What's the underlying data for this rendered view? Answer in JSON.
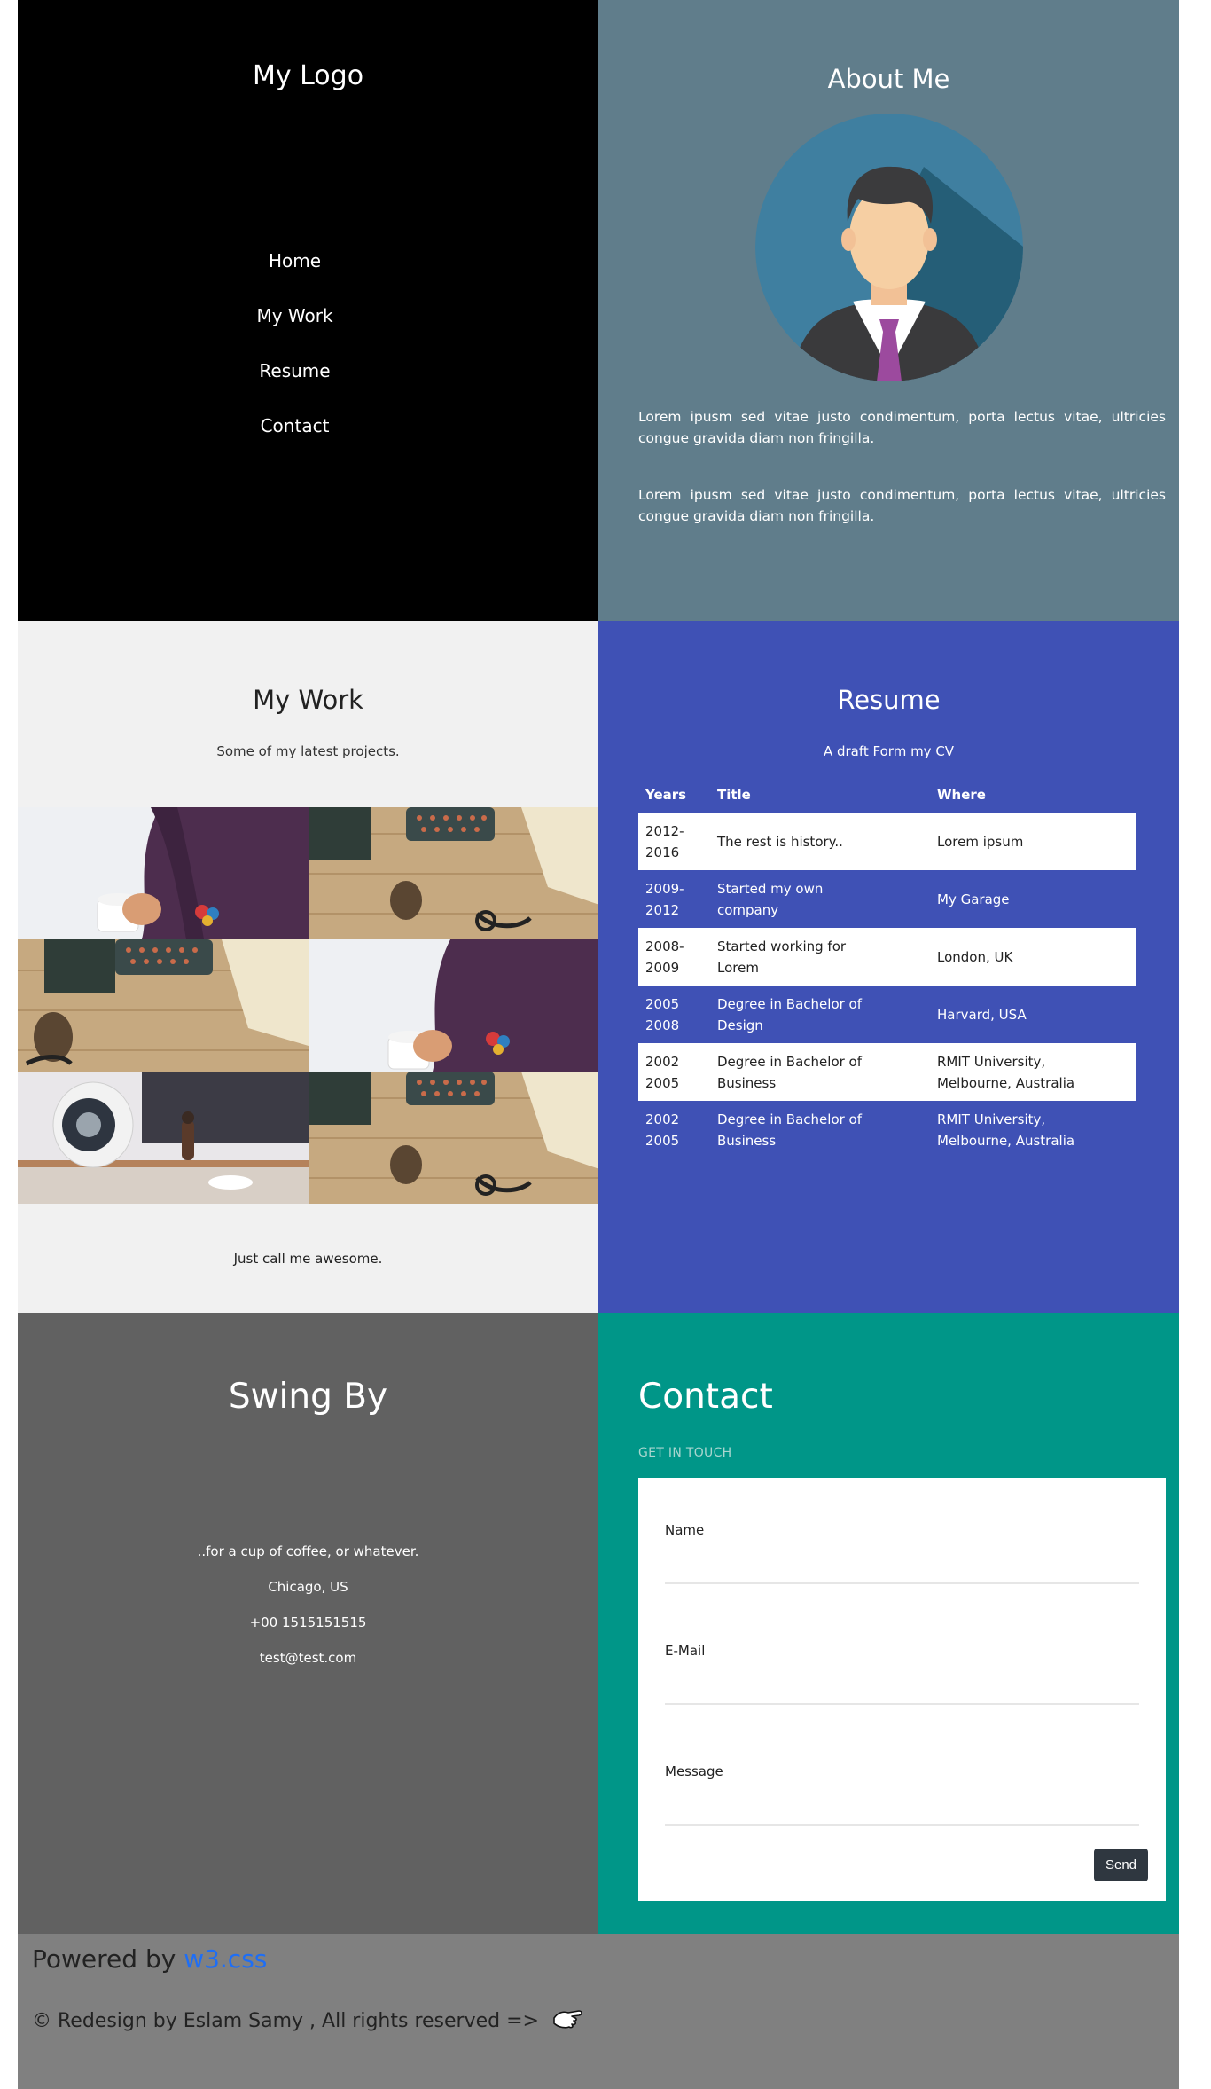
{
  "sidebar": {
    "logo": "My Logo",
    "nav": [
      "Home",
      "My Work",
      "Resume",
      "Contact"
    ]
  },
  "about": {
    "title": "About Me",
    "paragraphs": [
      "Lorem ipusm sed vitae justo condimentum, porta lectus vitae, ultricies congue gravida diam non fringilla.",
      "Lorem ipusm sed vitae justo condimentum, porta lectus vitae, ultricies congue gravida diam non fringilla."
    ]
  },
  "work": {
    "title": "My Work",
    "subtitle": "Some of my latest projects.",
    "tiles": [
      "coffee-vest-photo",
      "typewriter-desk-photo",
      "typewriter-desk-photo",
      "coffee-vest-photo",
      "speaker-desk-photo",
      "typewriter-desk-photo"
    ],
    "footer": "Just call me awesome."
  },
  "resume": {
    "title": "Resume",
    "subtitle": "A draft Form my CV",
    "headers": [
      "Years",
      "Title",
      "Where"
    ],
    "rows": [
      {
        "years": "2012-\n2016",
        "title": " The rest is history..",
        "where": " Lorem ipsum"
      },
      {
        "years": "2009-\n2012",
        "title": "Started my own\ncompany",
        "where": "My Garage"
      },
      {
        "years": "2008-\n2009",
        "title": "Started working for\nLorem",
        "where": "London, UK"
      },
      {
        "years": "2005\n2008",
        "title": "Degree in Bachelor of\nDesign",
        "where": "Harvard, USA"
      },
      {
        "years": "2002\n2005",
        "title": "Degree in Bachelor of\nBusiness",
        "where": "RMIT University,\nMelbourne, Australia"
      },
      {
        "years": "2002\n2005",
        "title": "Degree in Bachelor of\nBusiness",
        "where": "RMIT University,\nMelbourne, Australia"
      }
    ]
  },
  "swing": {
    "title": "Swing By",
    "lines": [
      "..for a cup of coffee, or whatever.",
      "Chicago, US",
      "+00 1515151515",
      "test@test.com"
    ]
  },
  "contact": {
    "title": "Contact",
    "tagline": "GET IN TOUCH",
    "fields": [
      "Name",
      "E-Mail",
      "Message"
    ],
    "send": "Send"
  },
  "footer": {
    "powered_prefix": "Powered by ",
    "powered_link": "w3.css",
    "copyright": "© Redesign by Eslam Samy , All rights reserved =>"
  },
  "colors": {
    "sidebar": "#000000",
    "about": "#607d8b",
    "work": "#f1f1f1",
    "resume": "#3f51b5",
    "swing": "#616161",
    "contact": "#009688",
    "footer": "#808080",
    "link": "#1e6ef5"
  }
}
